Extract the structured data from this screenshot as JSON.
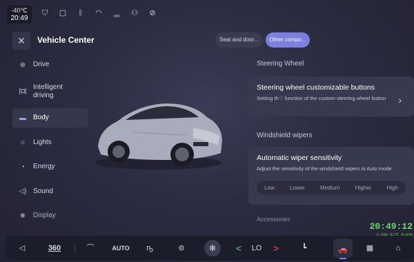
{
  "status": {
    "temperature": "-40℃",
    "time": "20:49",
    "icons": [
      "shield-icon",
      "rounded-square-icon",
      "bluetooth-icon",
      "hotspot-icon",
      "signal-icon",
      "person-icon",
      "location-off-icon"
    ]
  },
  "header": {
    "title": "Vehicle Center",
    "tabs": [
      "Seat and door...",
      "Other compo..."
    ],
    "active_tab": 1
  },
  "sidebar": {
    "items": [
      {
        "label": "Drive",
        "icon": "drive-icon"
      },
      {
        "label": "Intelligent driving",
        "icon": "intelligent-driving-icon"
      },
      {
        "label": "Body",
        "icon": "car-body-icon"
      },
      {
        "label": "Lights",
        "icon": "light-icon"
      },
      {
        "label": "Energy",
        "icon": "energy-icon"
      },
      {
        "label": "Sound",
        "icon": "speaker-icon"
      },
      {
        "label": "Display",
        "icon": "display-icon"
      }
    ],
    "active_index": 2
  },
  "steering": {
    "section_title": "Steering Wheel",
    "card_title": "Steering wheel customizable buttons",
    "card_desc": "Setting th♡ function of the custom steering wheel button"
  },
  "wipers": {
    "section_title": "Windshield wipers",
    "card_title": "Automatic wiper sensitivity",
    "card_desc": "Adjust the sensitivity of the windshield wipers in Auto mode.",
    "options": [
      "Low",
      "Lower",
      "Medium",
      "Higher",
      "High"
    ]
  },
  "accessories": "Accessories",
  "overlay": {
    "clock": "20:49:12",
    "stats": "C:26%_51℃ M:64%"
  },
  "dock": {
    "items": {
      "volume": "◁",
      "view360": "360",
      "seat": "⌒",
      "auto": "AUTO",
      "defrost": "ҧ",
      "car_air": "⊜",
      "fan": "✻",
      "temp_left": "<",
      "temp_value": "LO",
      "temp_right": ">",
      "seat2": "┗",
      "vehicle": "🚗",
      "apps": "▦",
      "home": "⌂"
    },
    "selected": "vehicle"
  },
  "colors": {
    "accent": "#7b7fe0",
    "green": "#6fd86d",
    "red": "#ff4d4d",
    "teal": "#4fd0a0"
  }
}
